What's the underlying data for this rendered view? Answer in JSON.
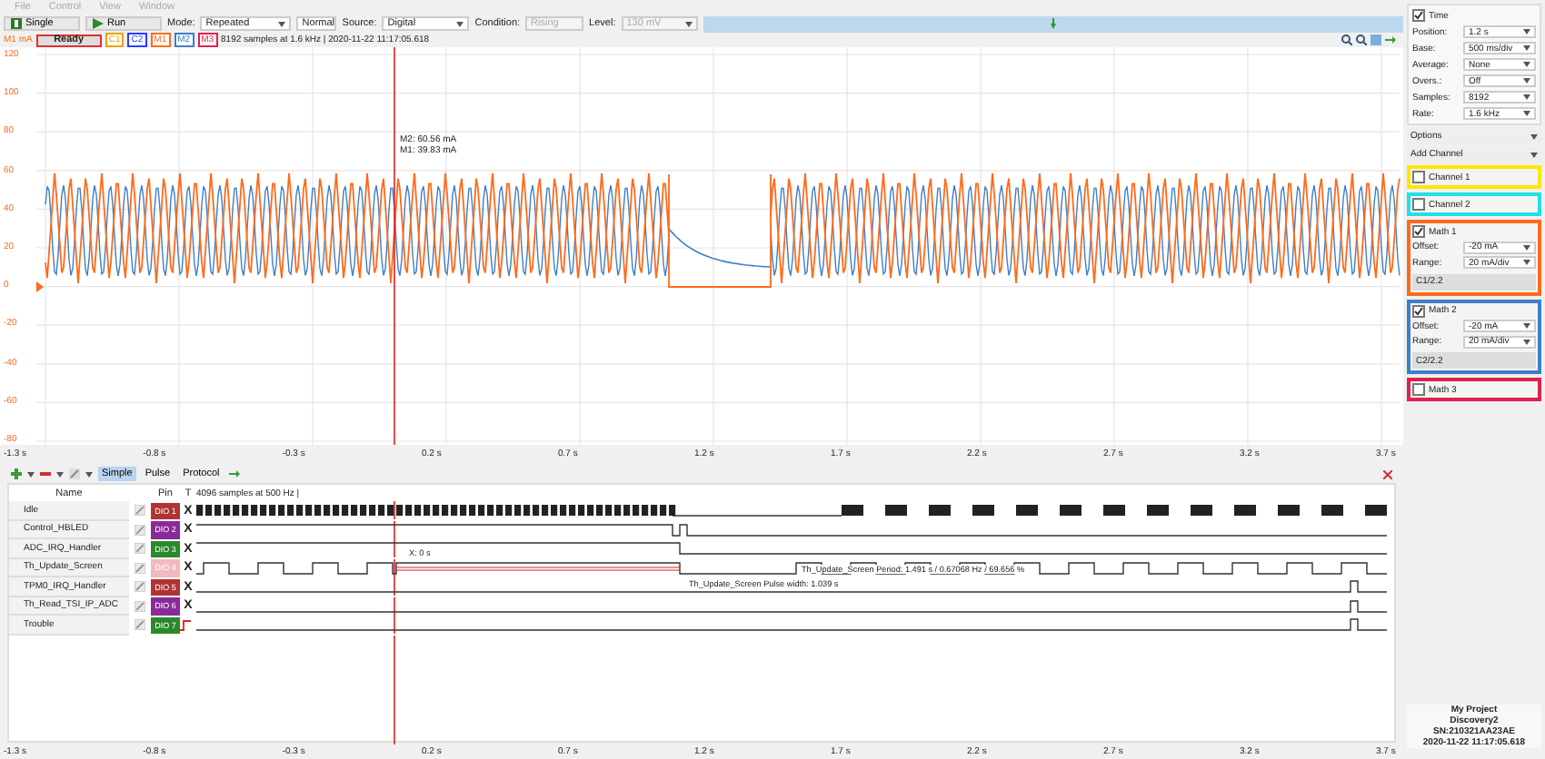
{
  "menu": [
    {
      "label": "File"
    },
    {
      "label": "Control"
    },
    {
      "label": "View"
    },
    {
      "label": "Window"
    }
  ],
  "toolbar": {
    "single": "Single",
    "run": "Run",
    "mode_label": "Mode:",
    "mode": "Repeated",
    "trigger_type": "Normal",
    "source_label": "Source:",
    "source": "Digital",
    "condition_label": "Condition:",
    "condition": "Rising",
    "condition_disabled": true,
    "level_label": "Level:",
    "level_value": "130 mV",
    "level_disabled": true
  },
  "status": {
    "unit": "M1 mA",
    "state": "Ready",
    "tags": [
      {
        "label": "C1",
        "color": "#f0a000"
      },
      {
        "label": "C2",
        "color": "#2a3cff"
      },
      {
        "label": "M1",
        "color": "#ff6a1a"
      },
      {
        "label": "M2",
        "color": "#3f7fc8"
      },
      {
        "label": "M3",
        "color": "#e0204f"
      }
    ],
    "info": "8192 samples at 1.6 kHz | 2020-11-22 11:17:05.618"
  },
  "plot": {
    "y_labels": [
      "120",
      "100",
      "80",
      "60",
      "40",
      "20",
      "0",
      "-20",
      "-40",
      "-60",
      "-80"
    ],
    "x_labels": [
      "-1.3 s",
      "-0.8 s",
      "-0.3 s",
      "0.2 s",
      "0.7 s",
      "1.2 s",
      "1.7 s",
      "2.2 s",
      "2.7 s",
      "3.2 s",
      "3.7 s"
    ],
    "cursor_readout": [
      "M2: 60.56 mA",
      "M1: 39.83 mA"
    ]
  },
  "logic": {
    "tabs": [
      {
        "label": "Simple",
        "selected": true
      },
      {
        "label": "Pulse",
        "selected": false
      },
      {
        "label": "Protocol",
        "selected": false
      }
    ],
    "columns": [
      "Name",
      "Pin",
      "T"
    ],
    "info": "4096 samples at 500 Hz |",
    "signals": [
      {
        "name": "Idle",
        "pin": "DIO 1",
        "color": "#b03434",
        "trigger": "X"
      },
      {
        "name": "Control_HBLED",
        "pin": "DIO 2",
        "color": "#8a2a9a",
        "trigger": "X"
      },
      {
        "name": "ADC_IRQ_Handler",
        "pin": "DIO 3",
        "color": "#2a8a2a",
        "trigger": "X"
      },
      {
        "name": "Th_Update_Screen",
        "pin": "DIO 4",
        "color": "#f4b8c0",
        "trigger": "X"
      },
      {
        "name": "TPM0_IRQ_Handler",
        "pin": "DIO 5",
        "color": "#b03434",
        "trigger": "X"
      },
      {
        "name": "Th_Read_TSI_IP_ADC",
        "pin": "DIO 6",
        "color": "#8a2a9a",
        "trigger": "X"
      },
      {
        "name": "Trouble",
        "pin": "DIO 7",
        "color": "#2a8a2a",
        "trigger": {
          "kind": "rising"
        }
      }
    ],
    "measurements": [
      "X: 0 s",
      "Th_Update_Screen Period: 1.491 s / 0.67068 Hz / 69.656 %",
      "Th_Update_Screen Pulse width: 1.039 s"
    ],
    "x_labels": [
      "-1.3 s",
      "-0.8 s",
      "-0.3 s",
      "0.2 s",
      "0.7 s",
      "1.2 s",
      "1.7 s",
      "2.2 s",
      "2.7 s",
      "3.2 s",
      "3.7 s"
    ]
  },
  "panel": {
    "time": {
      "title": "Time",
      "checked": true,
      "fields": [
        {
          "label": "Position:",
          "value": "1.2 s"
        },
        {
          "label": "Base:",
          "value": "500 ms/div"
        },
        {
          "label": "Average:",
          "value": "None"
        },
        {
          "label": "Overs.:",
          "value": "Off"
        },
        {
          "label": "Samples:",
          "value": "8192"
        },
        {
          "label": "Rate:",
          "value": "1.6 kHz"
        }
      ]
    },
    "options": "Options",
    "add_channel": "Add Channel",
    "channels": [
      {
        "name": "Channel 1",
        "checked": false,
        "color": "#ffe600"
      },
      {
        "name": "Channel 2",
        "checked": false,
        "color": "#20e0e8"
      },
      {
        "name": "Math 1",
        "checked": true,
        "color": "#ff6a1a",
        "fields": [
          {
            "label": "Offset:",
            "value": "-20 mA"
          },
          {
            "label": "Range:",
            "value": "20 mA/div"
          }
        ],
        "formula": "C1/2.2"
      },
      {
        "name": "Math 2",
        "checked": true,
        "color": "#3f7fc8",
        "fields": [
          {
            "label": "Offset:",
            "value": "-20 mA"
          },
          {
            "label": "Range:",
            "value": "20 mA/div"
          }
        ],
        "formula": "C2/2.2"
      },
      {
        "name": "Math 3",
        "checked": false,
        "color": "#e0204f"
      }
    ],
    "footer": [
      "My Project",
      "Discovery2",
      "SN:210321AA23AE",
      "2020-11-22 11:17:05.618"
    ]
  }
}
